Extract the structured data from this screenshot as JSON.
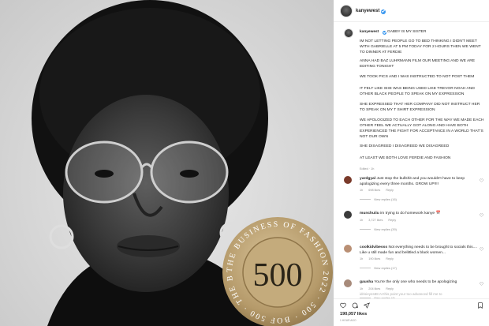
{
  "post": {
    "username": "kanyewest",
    "avatar_icon": "profile-avatar",
    "caption_title": "GABBY IS MY SISTER",
    "caption_paragraphs": [
      "IM NOT LETTING PEOPLE GO TO BED THINKING I DIDN'T MEET WITH GABRIELLE AT 5 PM TODAY FOR 2 HOURS THEN WE WENT TO DINNER AT FERDIE",
      "ANNA HAD BAZ LUHRMANN FILM OUR MEETING AND WE ARE EDITING TONIGHT",
      "WE TOOK PICS AND I WAS INSTRUCTED TO NOT POST THEM",
      "IT FELT LIKE SHE WAS BEING USED LIKE TREVOR NOAH AND OTHER BLACK PEOPLE TO SPEAK ON MY EXPRESSION",
      "SHE EXPRESSED THAT HER COMPANY DID NOT INSTRUCT HER TO SPEAK ON MY T SHIRT EXPRESSION",
      "WE APOLOGIZED TO EACH OTHER FOR THE WAY WE MADE EACH OTHER FEEL WE ACTUALLY GOT ALONG AND HAVE BOTH EXPERIENCED THE FIGHT FOR ACCEPTANCE IN A WORLD THAT'S NOT OUR OWN",
      "SHE DISAGREED I DISAGREED WE DISAGREED",
      "AT LEAST WE BOTH LOVE FERDIE AND FASHION"
    ],
    "caption_meta": "Edited · 1h",
    "likes": "190,057 likes",
    "time_ago": "1 HOUR AGO",
    "badge_number": "500",
    "badge_ring_text": "THE BUSINESS OF FASHION 2022 · 500 · BOF 500 · THE BUSINESS OF FASHION"
  },
  "comments": [
    {
      "username": "yardgyal",
      "text": "Just stop the bullshit and you wouldn't have to keep apologizing every three months. GROW UP!!!!",
      "time": "1h",
      "likes": "698 likes",
      "reply": "Reply",
      "view_replies": "View replies (16)",
      "avatar_color": "#7a3a2a"
    },
    {
      "username": "munchuiiu",
      "text": "im trying to do homework kanye 📅",
      "time": "1h",
      "likes": "3,727 likes",
      "reply": "Reply",
      "view_replies": "View replies (39)",
      "avatar_color": "#3b3b3b"
    },
    {
      "username": "coolkidvibesss",
      "text": "Not everything needs to be brought to socials this.... Like u still made fun and belittled a black women...",
      "time": "1h",
      "likes": "190 likes",
      "reply": "Reply",
      "view_replies": "View replies (17)",
      "avatar_color": "#b98f74"
    },
    {
      "username": "gausha",
      "text": "You're the only one who needs to be apologizing",
      "time": "1h",
      "likes": "204 likes",
      "reply": "Reply",
      "view_replies": "View replies (4)",
      "avatar_color": "#a78a7a"
    }
  ],
  "partial_comment": "idrisieyes88  At this point your too advanced fill me to",
  "colors": {
    "verified": "#3897f0",
    "muted_text": "#8e8e8e",
    "badge_gold": "#b59a6a"
  }
}
